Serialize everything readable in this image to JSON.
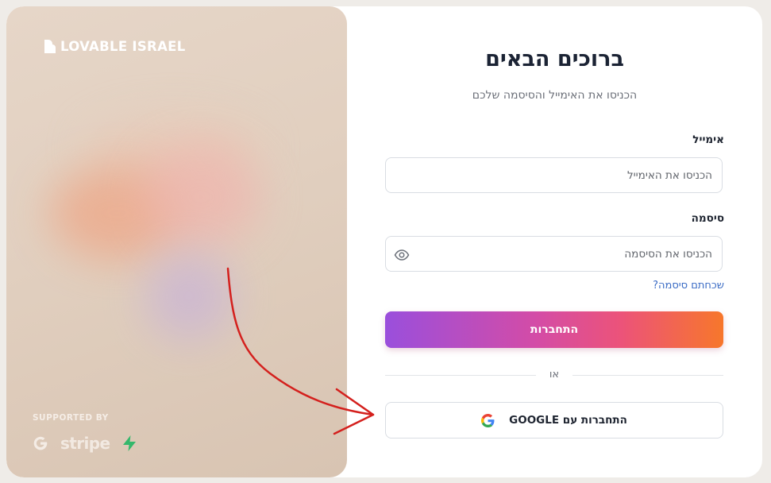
{
  "brand": {
    "name": "LOVABLE ISRAEL"
  },
  "side": {
    "supported_by": "SUPPORTED BY",
    "partners": [
      "google-icon",
      "Stripe",
      "supabase-icon"
    ],
    "stripe_label": "stripe"
  },
  "form": {
    "title": "ברוכים הבאים",
    "subtitle": "הכניסו את האימייל והסיסמה שלכם",
    "email_label": "אימייל",
    "email_placeholder": "הכניסו את האימייל",
    "password_label": "סיסמה",
    "password_placeholder": "הכניסו את הסיסמה",
    "forgot_link": "שכחתם סיסמה?",
    "login_button": "התחברות",
    "divider_text": "או",
    "google_button": "התחברות עם GOOGLE"
  },
  "colors": {
    "gradient_start": "#9a4fdc",
    "gradient_end": "#f7772b",
    "link": "#3b6cc5",
    "annotation_arrow": "#d4201d"
  }
}
